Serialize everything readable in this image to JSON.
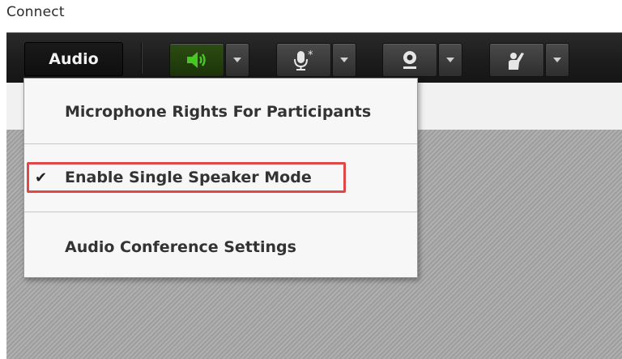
{
  "app": {
    "title": "Connect"
  },
  "toolbar": {
    "audio_menu_label": "Audio",
    "buttons": [
      {
        "name": "speaker",
        "icon": "speaker-volume-icon",
        "active": true,
        "color": "#3fbf1f"
      },
      {
        "name": "microphone",
        "icon": "microphone-icon"
      },
      {
        "name": "webcam",
        "icon": "webcam-icon"
      },
      {
        "name": "raise-hand",
        "icon": "raise-hand-icon"
      }
    ],
    "dropdown_icon": "chevron-down-icon"
  },
  "menu": {
    "items": [
      {
        "label": "Microphone Rights For Participants",
        "checked": false
      },
      {
        "label": "Enable Single Speaker Mode",
        "checked": true,
        "check_glyph": "✔",
        "highlighted": true
      },
      {
        "label": "Audio Conference Settings",
        "checked": false
      }
    ]
  },
  "colors": {
    "highlight": "#e04848",
    "toolbar": "#1f1f1f",
    "speaker_active": "#3fbf1f"
  }
}
